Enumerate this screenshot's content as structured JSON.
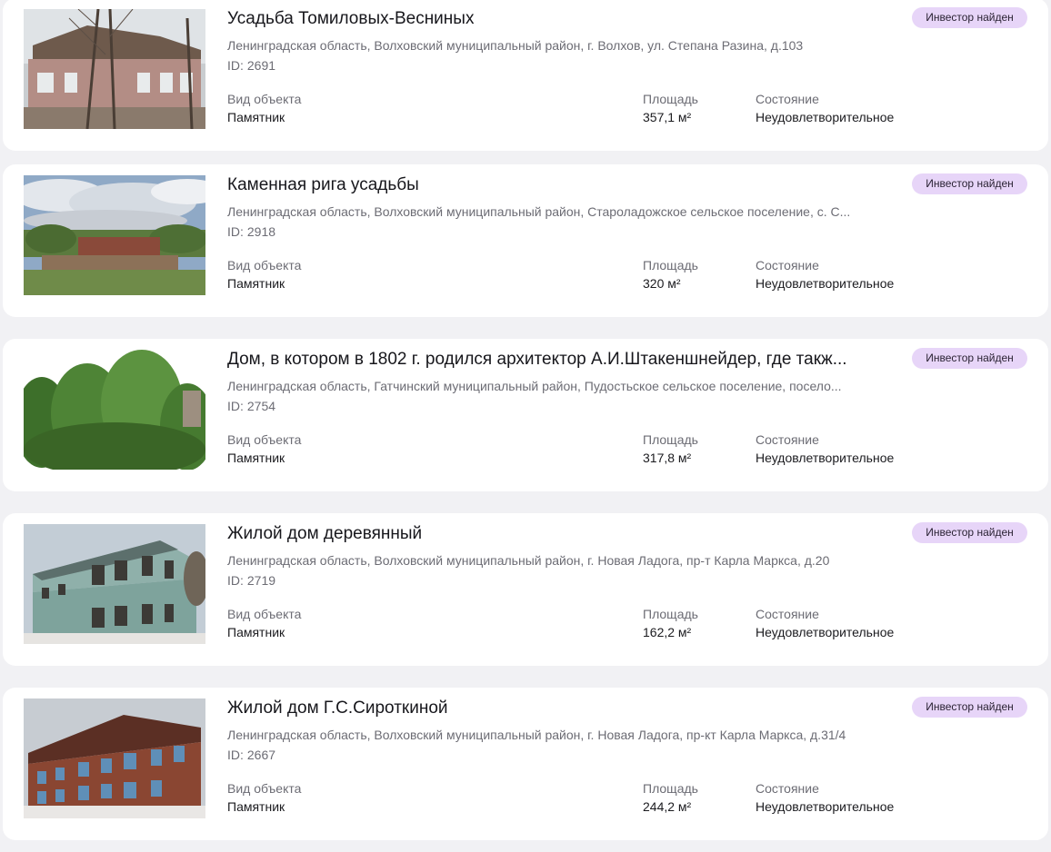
{
  "labels": {
    "kind": "Вид объекта",
    "area": "Площадь",
    "condition": "Состояние",
    "id_prefix": "ID:"
  },
  "objects": [
    {
      "title": "Усадьба Томиловых-Весниных",
      "address": "Ленинградская область, Волховский муниципальный район, г. Волхов, ул. Степана Разина, д.103",
      "id": "2691",
      "badge": "Инвестор найден",
      "kind": "Памятник",
      "area": "357,1 м²",
      "condition": "Неудовлетворительное"
    },
    {
      "title": "Каменная рига усадьбы",
      "address": "Ленинградская область, Волховский муниципальный район, Староладожское сельское поселение, с. С...",
      "id": "2918",
      "badge": "Инвестор найден",
      "kind": "Памятник",
      "area": "320 м²",
      "condition": "Неудовлетворительное"
    },
    {
      "title": "Дом, в котором в 1802 г. родился архитектор А.И.Штакеншнейдер, где такж...",
      "address": "Ленинградская область, Гатчинский муниципальный район, Пудостьское сельское поселение, посело...",
      "id": "2754",
      "badge": "Инвестор найден",
      "kind": "Памятник",
      "area": "317,8 м²",
      "condition": "Неудовлетворительное"
    },
    {
      "title": "Жилой дом деревянный",
      "address": "Ленинградская область, Волховский муниципальный район, г. Новая Ладога, пр-т Карла Маркса, д.20",
      "id": "2719",
      "badge": "Инвестор найден",
      "kind": "Памятник",
      "area": "162,2 м²",
      "condition": "Неудовлетворительное"
    },
    {
      "title": "Жилой дом Г.С.Сироткиной",
      "address": "Ленинградская область, Волховский муниципальный район, г. Новая Ладога, пр-кт Карла Маркса, д.31/4",
      "id": "2667",
      "badge": "Инвестор найден",
      "kind": "Памятник",
      "area": "244,2 м²",
      "condition": "Неудовлетворительное"
    }
  ]
}
